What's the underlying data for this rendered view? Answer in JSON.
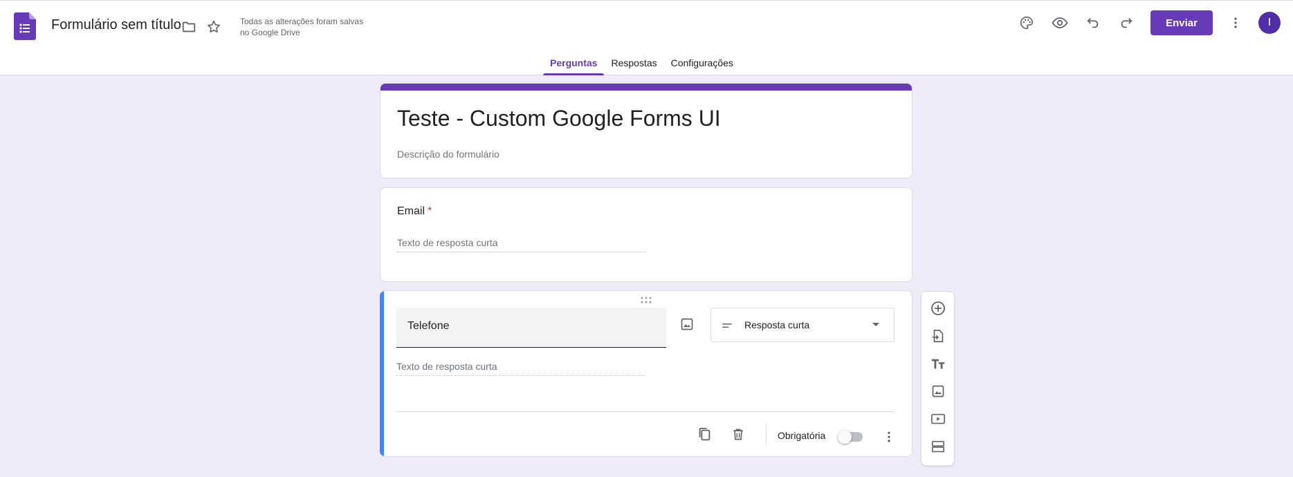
{
  "header": {
    "doc_title": "Formulário sem título",
    "save_status": "Todas as alterações foram salvas no Google Drive",
    "send_label": "Enviar",
    "avatar_initial": "I",
    "icons": [
      "folder-icon",
      "star-icon",
      "palette-icon",
      "preview-eye-icon",
      "undo-icon",
      "redo-icon",
      "more-vert-icon"
    ]
  },
  "tabs": [
    {
      "label": "Perguntas",
      "active": true
    },
    {
      "label": "Respostas",
      "active": false
    },
    {
      "label": "Configurações",
      "active": false
    }
  ],
  "form": {
    "title": "Teste - Custom Google Forms UI",
    "description_placeholder": "Descrição do formulário"
  },
  "questions": [
    {
      "label": "Email",
      "required": true,
      "required_mark": "*",
      "answer_placeholder": "Texto de resposta curta"
    },
    {
      "label": "Telefone",
      "type_label": "Resposta curta",
      "answer_placeholder": "Texto de resposta curta",
      "required_label": "Obrigatória",
      "required": false
    }
  ],
  "side_toolbar": [
    "add-question-icon",
    "import-questions-icon",
    "add-title-icon",
    "add-image-icon",
    "add-video-icon",
    "add-section-icon"
  ],
  "colors": {
    "accent": "#673ab7",
    "background": "#f0ebf8",
    "active_question": "#4285f4"
  }
}
